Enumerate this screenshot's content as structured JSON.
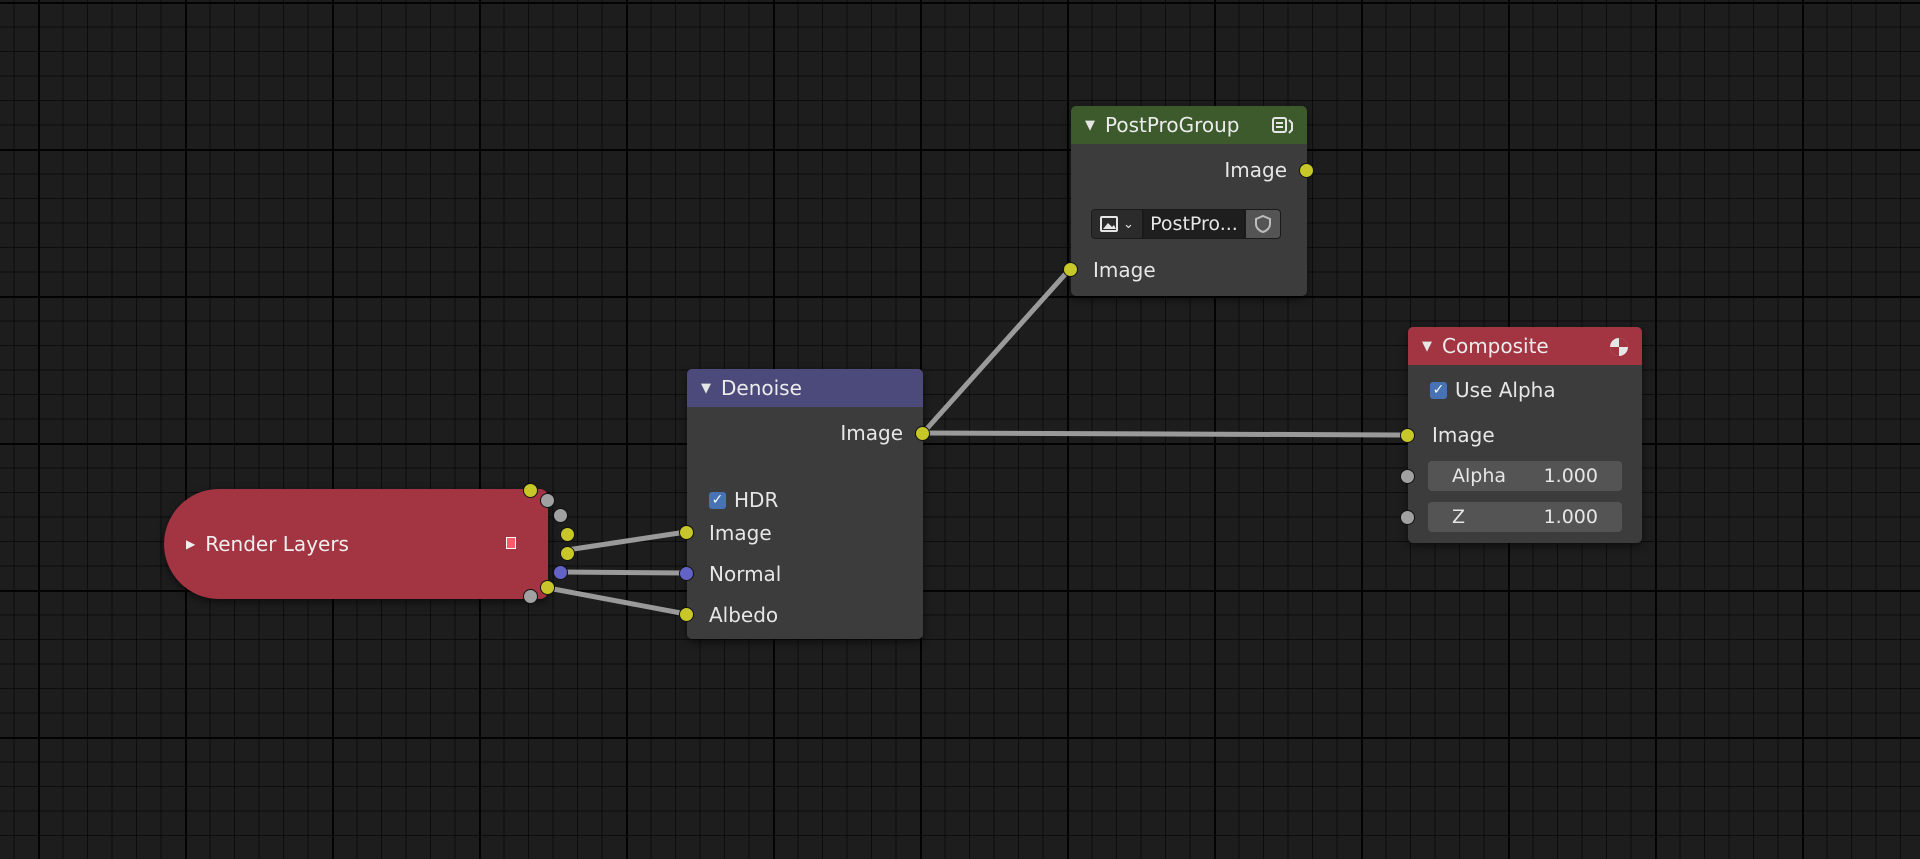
{
  "nodes": {
    "render_layers": {
      "title": "Render Layers",
      "header_color": "#a33442"
    },
    "denoise": {
      "title": "Denoise",
      "header_color": "#4b4a7a",
      "output_image": "Image",
      "hdr_label": "HDR",
      "hdr_checked": true,
      "input_image": "Image",
      "input_normal": "Normal",
      "input_albedo": "Albedo"
    },
    "postprogroup": {
      "title": "PostProGroup",
      "header_color": "#3c5a2b",
      "output_image": "Image",
      "group_name": "PostPro...",
      "input_image": "Image",
      "icon": "node-group-icon"
    },
    "composite": {
      "title": "Composite",
      "header_color": "#a33442",
      "use_alpha_label": "Use Alpha",
      "use_alpha_checked": true,
      "input_image": "Image",
      "alpha_label": "Alpha",
      "alpha_value": "1.000",
      "z_label": "Z",
      "z_value": "1.000",
      "icon": "render-globe-icon"
    }
  },
  "colors": {
    "socket_image": "#c7c729",
    "socket_value": "#a1a1a1",
    "socket_vector": "#6363c7",
    "link": "#9a9a9a",
    "background": "#1d1d1d"
  }
}
